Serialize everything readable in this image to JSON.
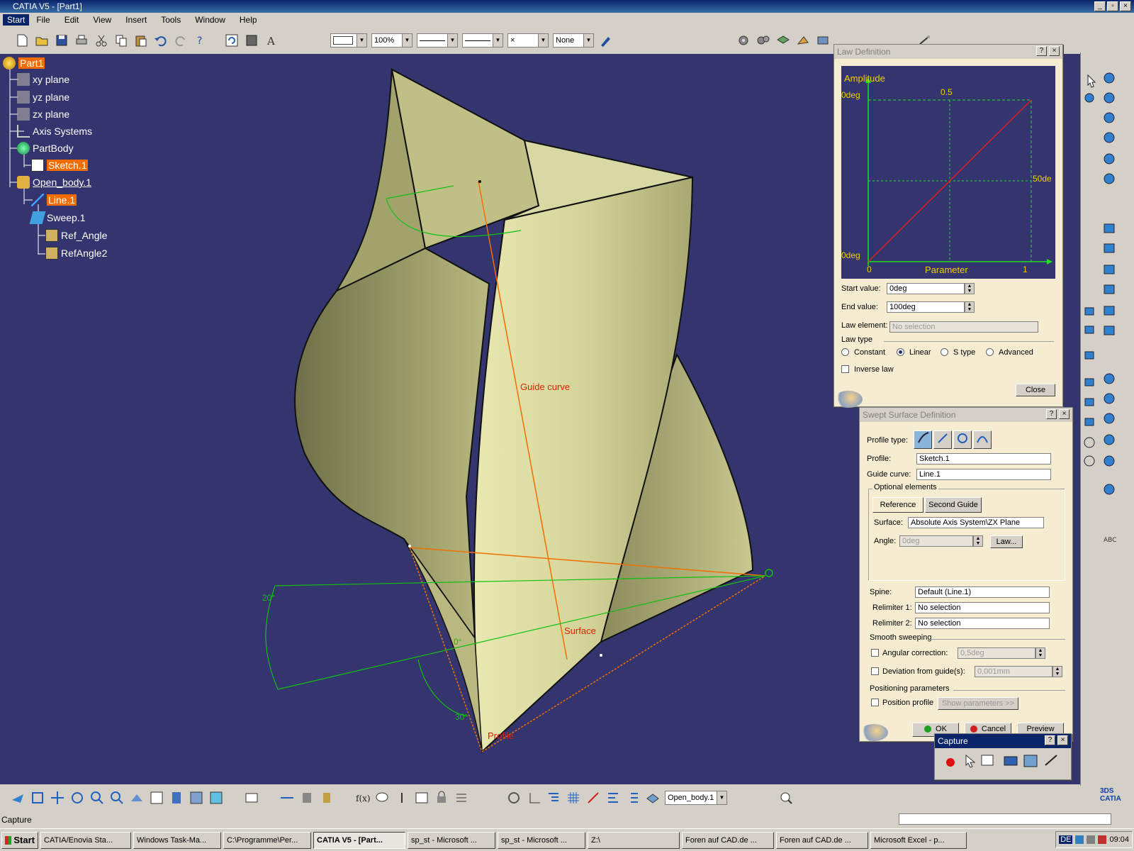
{
  "window": {
    "title": "CATIA V5 - [Part1]"
  },
  "menu": [
    "Start",
    "File",
    "Edit",
    "View",
    "Insert",
    "Tools",
    "Window",
    "Help"
  ],
  "toolbar": {
    "zoom_value": "100%",
    "layer_value": "None"
  },
  "tree": {
    "root": "Part1",
    "items": [
      "xy plane",
      "yz plane",
      "zx plane",
      "Axis Systems",
      "PartBody",
      "Sketch.1",
      "Open_body.1",
      "Line.1",
      "Sweep.1",
      "Ref_Angle",
      "RefAngle2"
    ]
  },
  "viewport": {
    "labels": {
      "guide": "Guide curve",
      "surface": "Surface",
      "profile": "Profile",
      "angle1": "20°",
      "angle2": "0°",
      "angle3": "30°"
    }
  },
  "law_dialog": {
    "title": "Law Definition",
    "graph": {
      "ylabel": "Amplitude",
      "xlabel": "Parameter",
      "y_top": "0deg",
      "y_bottom": "0deg",
      "x_start": "0",
      "x_mid": "0.5",
      "x_end": "1",
      "y_mid": "50de"
    },
    "start_label": "Start value:",
    "start_value": "0deg",
    "end_label": "End value:",
    "end_value": "100deg",
    "law_element_label": "Law element:",
    "law_element_placeholder": "No selection",
    "law_type_label": "Law type",
    "types": [
      "Constant",
      "Linear",
      "S type",
      "Advanced"
    ],
    "selected_type": "Linear",
    "inverse_label": "Inverse law",
    "close_label": "Close"
  },
  "swept_dialog": {
    "title": "Swept Surface Definition",
    "profile_type_label": "Profile type:",
    "profile_label": "Profile:",
    "profile_value": "Sketch.1",
    "guide_label": "Guide curve:",
    "guide_value": "Line.1",
    "optional_label": "Optional elements",
    "tabs": [
      "Reference",
      "Second Guide"
    ],
    "surface_label": "Surface:",
    "surface_value": "Absolute Axis System\\ZX Plane",
    "angle_label": "Angle:",
    "angle_value": "0deg",
    "law_button": "Law...",
    "spine_label": "Spine:",
    "spine_value": "Default (Line.1)",
    "relim1_label": "Relimiter 1:",
    "relim1_value": "No selection",
    "relim2_label": "Relimiter 2:",
    "relim2_value": "No selection",
    "smooth_label": "Smooth sweeping",
    "angular_label": "Angular correction:",
    "angular_value": "0,5deg",
    "deviation_label": "Deviation from guide(s):",
    "deviation_value": "0,001mm",
    "positioning_label": "Positioning parameters",
    "position_profile_label": "Position profile",
    "show_params": "Show parameters >>",
    "ok": "OK",
    "cancel": "Cancel",
    "preview": "Preview"
  },
  "capture_dialog": {
    "title": "Capture"
  },
  "bottom_toolbar": {
    "current_body": "Open_body.1"
  },
  "status": {
    "text": "Capture"
  },
  "taskbar": {
    "start": "Start",
    "tasks": [
      "CATIA/Enovia Sta...",
      "Windows Task-Ma...",
      "C:\\Programme\\Per...",
      "CATIA V5 - [Part...",
      "sp_st - Microsoft ...",
      "sp_st - Microsoft ...",
      "Z:\\",
      "Foren auf CAD.de ...",
      "Foren auf CAD.de ...",
      "Microsoft Excel - p..."
    ],
    "active_index": 3,
    "lang": "DE",
    "clock": "09:04"
  },
  "colors": {
    "viewport_bg": "#34346e",
    "surface": "#c8c88a",
    "highlight": "#f26c00",
    "dialog_bg": "#f5ecd2"
  }
}
